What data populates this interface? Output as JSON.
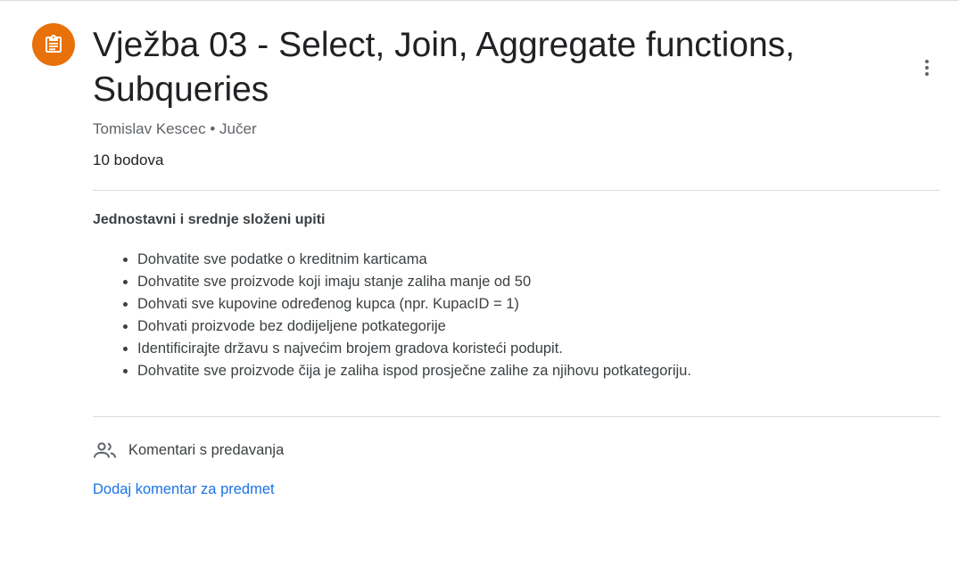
{
  "colors": {
    "accent_orange": "#e8710a",
    "link_blue": "#1a73e8",
    "text_primary": "#202124",
    "text_secondary": "#5f6368",
    "divider": "#dadce0"
  },
  "header": {
    "icon": "assignment-icon",
    "title": "Vježba 03 - Select, Join, Aggregate functions, Subqueries",
    "author": "Tomislav Kescec",
    "separator": "•",
    "posted": "Jučer",
    "points": "10 bodova",
    "more_icon": "more-vert-icon"
  },
  "description": {
    "heading": "Jednostavni i srednje složeni upiti",
    "tasks": [
      "Dohvatite sve podatke o kreditnim karticama",
      "Dohvatite sve proizvode koji imaju stanje zaliha manje od 50",
      "Dohvati sve kupovine određenog kupca (npr. KupacID = 1)",
      "Dohvati proizvode bez dodijeljene potkategorije",
      "Identificirajte državu s najvećim brojem gradova koristeći podupit.",
      "Dohvatite sve proizvode čija je zaliha ispod prosječne zalihe za njihovu potkategoriju."
    ]
  },
  "comments": {
    "icon": "people-icon",
    "label": "Komentari s predavanja",
    "add_link": "Dodaj komentar za predmet"
  }
}
